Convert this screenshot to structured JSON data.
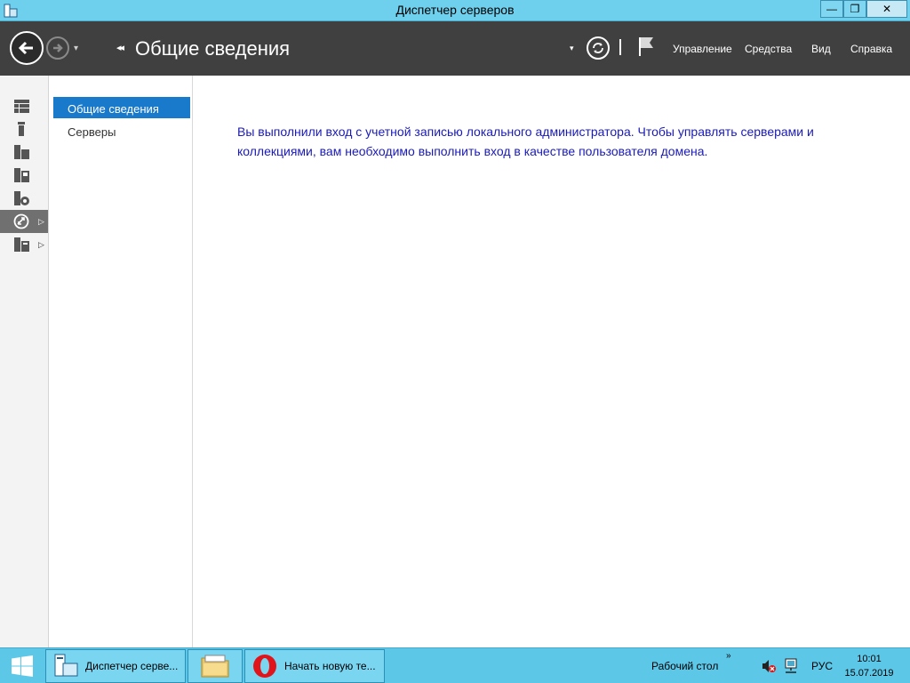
{
  "window": {
    "title": "Диспетчер серверов",
    "minimize_glyph": "—",
    "maximize_glyph": "❐",
    "close_glyph": "✕"
  },
  "header": {
    "page_title": "Общие сведения",
    "breadcrumb_glyph": "◂◂",
    "dropdown_glyph": "▾",
    "menus": [
      "Управление",
      "Средства",
      "Вид",
      "Справка"
    ]
  },
  "rail": {
    "items": [
      {
        "icon": "dashboard-icon"
      },
      {
        "icon": "local-server-icon"
      },
      {
        "icon": "all-servers-icon"
      },
      {
        "icon": "file-storage-icon"
      },
      {
        "icon": "iis-icon"
      },
      {
        "icon": "remote-desktop-icon",
        "selected": true,
        "expandable": true
      },
      {
        "icon": "file-services-icon",
        "expandable": true
      }
    ],
    "expand_glyph": "▷"
  },
  "navpane": {
    "items": [
      "Общие сведения",
      "Серверы"
    ]
  },
  "main": {
    "message": "Вы выполнили вход с учетной записью локального администратора. Чтобы управлять серверами и коллекциями, вам необходимо выполнить вход в качестве пользователя домена."
  },
  "taskbar": {
    "apps": [
      {
        "label": "Диспетчер серве...",
        "icon": "server-manager-icon"
      },
      {
        "label": "",
        "icon": "file-explorer-icon"
      },
      {
        "label": "Начать новую те...",
        "icon": "opera-icon"
      }
    ],
    "desktop_label": "Рабочий стол",
    "chevrons": "»",
    "language": "РУС",
    "time": "10:01",
    "date": "15.07.2019"
  },
  "colors": {
    "header_bg": "#404040",
    "accent": "#1979ca",
    "message_text": "#1a1ab8",
    "taskbar_bg": "#5dc7e8"
  }
}
